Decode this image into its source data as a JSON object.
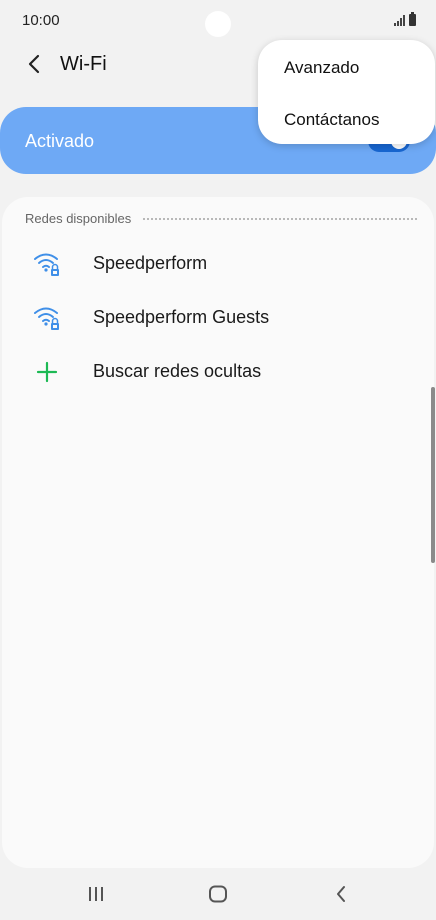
{
  "status_bar": {
    "time": "10:00"
  },
  "header": {
    "title": "Wi-Fi"
  },
  "wifi_toggle": {
    "label": "Activado",
    "state": "on"
  },
  "overflow_menu": {
    "items": [
      "Avanzado",
      "Contáctanos"
    ]
  },
  "networks": {
    "section_title": "Redes disponibles",
    "items": [
      {
        "name": "Speedperform",
        "icon": "wifi-locked-icon"
      },
      {
        "name": "Speedperform Guests",
        "icon": "wifi-locked-icon"
      }
    ],
    "add_hidden_label": "Buscar redes ocultas"
  },
  "colors": {
    "accent": "#6ea9f5",
    "switch_on": "#1867d2",
    "wifi_icon": "#3f8fe8",
    "add_icon": "#1db954"
  }
}
